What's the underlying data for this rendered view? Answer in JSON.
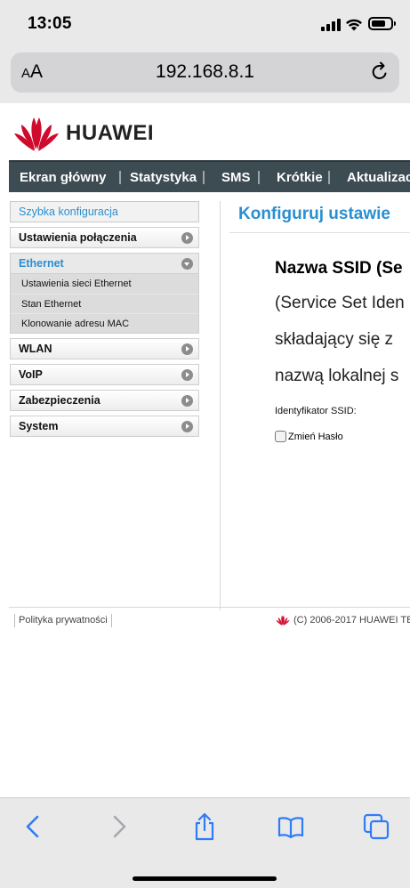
{
  "status_bar": {
    "time": "13:05"
  },
  "browser": {
    "aa_label_small": "A",
    "aa_label_big": "A",
    "url": "192.168.8.1"
  },
  "brand": {
    "name": "HUAWEI",
    "color": "#cf0a2c"
  },
  "nav": {
    "items": [
      "Ekran główny",
      "Statystyka",
      "SMS",
      "Krótkie",
      "Aktualizac"
    ]
  },
  "sidebar": {
    "quick": "Szybka konfiguracja",
    "connection": "Ustawienia połączenia",
    "ethernet": "Ethernet",
    "ethernet_sub": [
      "Ustawienia sieci Ethernet",
      "Stan Ethernet",
      "Klonowanie adresu MAC"
    ],
    "wlan": "WLAN",
    "voip": "VoIP",
    "security": "Zabezpieczenia",
    "system": "System"
  },
  "content": {
    "title": "Konfiguruj ustawie",
    "heading": "Nazwa SSID (Se",
    "lines": [
      "(Service Set Iden",
      "składający się z",
      "nazwą lokalnej s"
    ],
    "ssid_label": "Identyfikator SSID:",
    "change_password": "Zmień Hasło"
  },
  "footer": {
    "privacy": "Polityka prywatności",
    "copyright": "(C) 2006-2017 HUAWEI TE"
  },
  "colors": {
    "accent": "#2a8fd1",
    "nav_bg": "#3d4b53",
    "ios_blue": "#2f7cf6"
  }
}
